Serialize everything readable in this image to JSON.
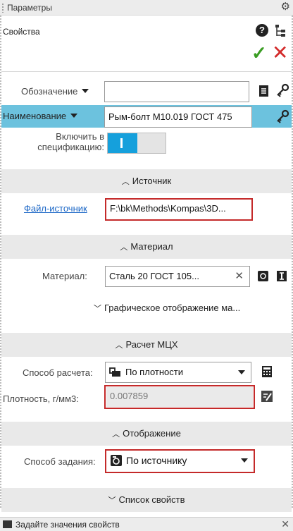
{
  "titlebar": {
    "title": "Параметры",
    "gear_icon": "gear-icon"
  },
  "panel": {
    "name": "Свойства"
  },
  "colors": {
    "accent_blue": "#15a0dc",
    "highlight_row": "#6cc2de",
    "ok_green": "#3a9d23",
    "cancel_red": "#d32a2a",
    "annotation_red": "#c42a2a"
  },
  "fields": {
    "oboznachenie": {
      "label": "Обозначение",
      "value": ""
    },
    "naimenovanie": {
      "label": "Наименование",
      "value": "Рым-болт М10.019 ГОСТ 475"
    },
    "include_spec": {
      "label": "Включить в спецификацию:",
      "state": "on"
    }
  },
  "sections": {
    "source": {
      "title": "Источник",
      "file_link": "Файл-источник",
      "file_path": "F:\\bk\\Methods\\Kompas\\3D..."
    },
    "material": {
      "title": "Материал",
      "label": "Материал:",
      "value": "Сталь 20 ГОСТ 105...",
      "graphic_sub": "Графическое отображение ма..."
    },
    "mch": {
      "title": "Расчет МЦХ",
      "method_label": "Способ расчета:",
      "method_value": "По плотности",
      "density_label": "Плотность, г/мм3:",
      "density_value": "0.007859"
    },
    "display": {
      "title": "Отображение",
      "mode_label": "Способ задания:",
      "mode_value": "По источнику"
    },
    "props": {
      "title": "Список свойств"
    }
  },
  "status": {
    "text": "Задайте значения свойств"
  }
}
